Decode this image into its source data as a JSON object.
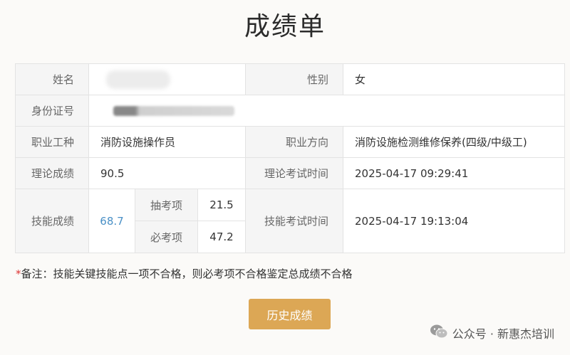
{
  "page_title": "成绩单",
  "table": {
    "name_label": "姓名",
    "name_value": "",
    "gender_label": "性别",
    "gender_value": "女",
    "id_label": "身份证号",
    "id_value": "",
    "occupation_label": "职业工种",
    "occupation_value": "消防设施操作员",
    "direction_label": "职业方向",
    "direction_value": "消防设施检测维修保养(四级/中级工)",
    "theory_label": "理论成绩",
    "theory_value": "90.5",
    "theory_time_label": "理论考试时间",
    "theory_time_value": "2025-04-17 09:29:41",
    "skill_label": "技能成绩",
    "skill_value": "68.7",
    "draw_label": "抽考项",
    "draw_value": "21.5",
    "required_label": "必考项",
    "required_value": "47.2",
    "skill_time_label": "技能考试时间",
    "skill_time_value": "2025-04-17 19:13:04"
  },
  "note": {
    "star": "*",
    "text": "备注：技能关键技能点一项不合格，则必考项不合格鉴定总成绩不合格"
  },
  "history_button": "历史成绩",
  "watermark": "公众号 · 新惠杰培训",
  "colors": {
    "button_bg": "#dca755",
    "skill_score": "#4a90c6",
    "note_star": "#dd3333"
  }
}
